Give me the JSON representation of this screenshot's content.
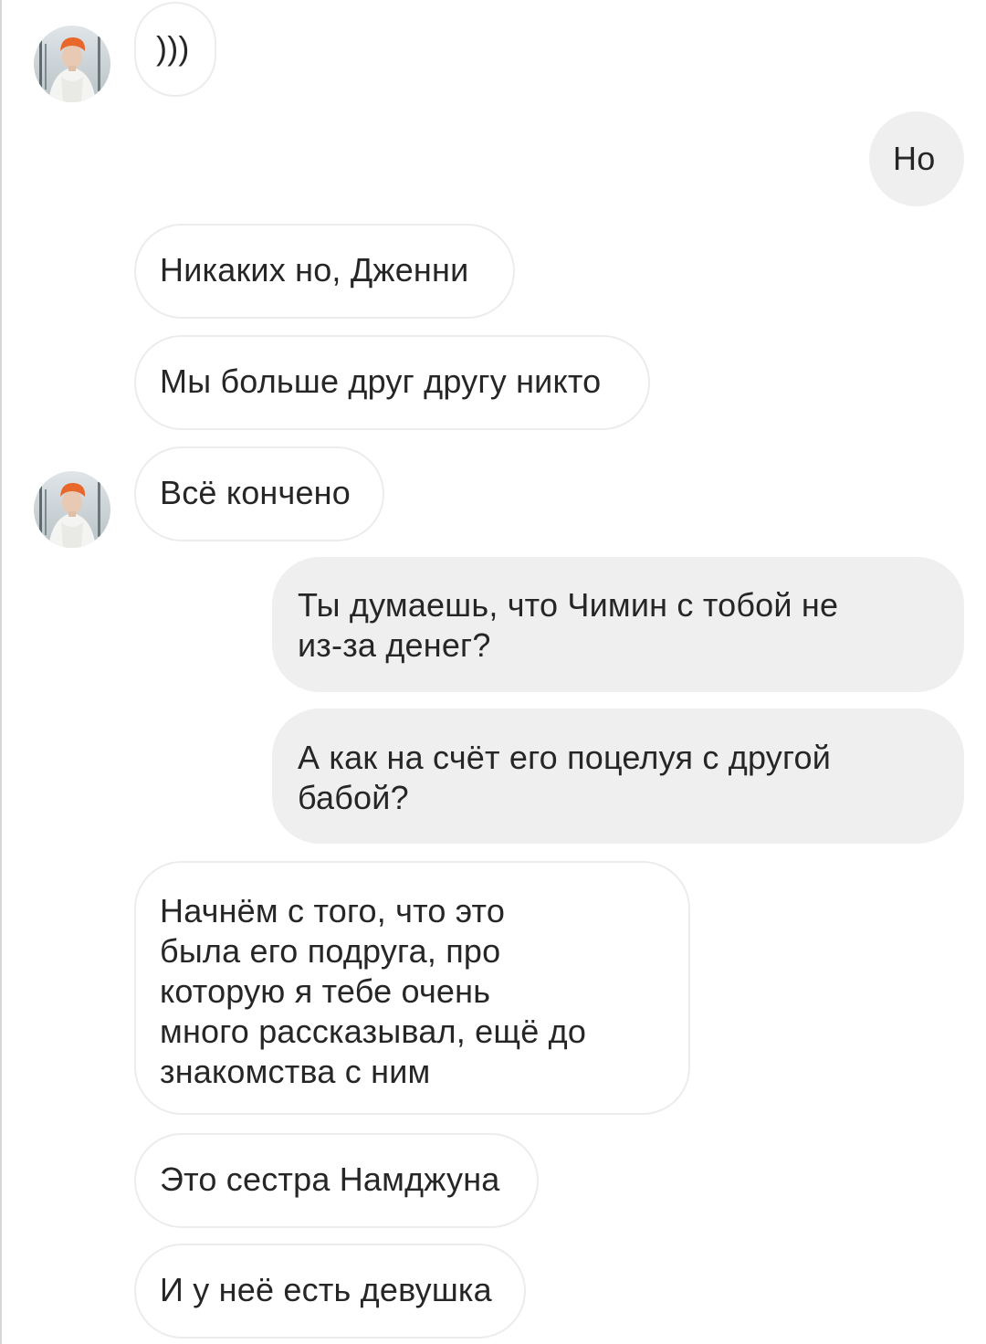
{
  "conversation": {
    "avatar_icon": "contact-avatar-icon",
    "messages": [
      {
        "side": "incoming",
        "text": ")))"
      },
      {
        "side": "outgoing",
        "text": "Но"
      },
      {
        "side": "incoming",
        "text": "Никаких но, Дженни"
      },
      {
        "side": "incoming",
        "text": "Мы больше друг другу никто"
      },
      {
        "side": "incoming",
        "text": "Всё кончено"
      },
      {
        "side": "outgoing",
        "text": "Ты думаешь, что Чимин с тобой не\nиз-за денег?"
      },
      {
        "side": "outgoing",
        "text": "А как на счёт его поцелуя с другой\nбабой?"
      },
      {
        "side": "incoming",
        "text": "Начнём с того, что это\nбыла его подруга, про\nкоторую я тебе очень\nмного рассказывал, ещё до\nзнакомства с ним"
      },
      {
        "side": "incoming",
        "text": "Это сестра Намджуна"
      },
      {
        "side": "incoming",
        "text": "И у неё есть девушка"
      }
    ]
  }
}
